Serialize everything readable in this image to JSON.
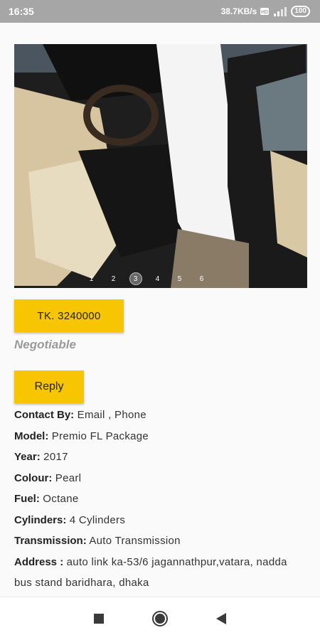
{
  "status_bar": {
    "time": "16:35",
    "network_speed": "38.7KB/s",
    "battery": "100",
    "icons": [
      "wifi-data-icon",
      "signal-icon",
      "battery-icon"
    ]
  },
  "gallery": {
    "image_alt": "car interior",
    "pages": [
      "1",
      "2",
      "3",
      "4",
      "5",
      "6"
    ],
    "active_page": "3"
  },
  "price": {
    "label": "TK. 3240000",
    "note": "Negotiable"
  },
  "actions": {
    "reply_label": "Reply"
  },
  "details": [
    {
      "key": "Contact By:",
      "value": " Email , Phone"
    },
    {
      "key": "Model:",
      "value": " Premio FL Package"
    },
    {
      "key": "Year:",
      "value": " 2017"
    },
    {
      "key": "Colour:",
      "value": " Pearl"
    },
    {
      "key": "Fuel:",
      "value": " Octane"
    },
    {
      "key": "Cylinders:",
      "value": " 4 Cylinders"
    },
    {
      "key": "Transmission:",
      "value": " Auto Transmission"
    },
    {
      "key": "Address :",
      "value": " auto link ka-53/6 jagannathpur,vatara, nadda bus stand baridhara, dhaka"
    }
  ],
  "colors": {
    "accent": "#f7c501",
    "status_bar": "#a6a6a6",
    "muted_text": "#9a9a9a"
  },
  "nav": {
    "icons": [
      "recents-square-icon",
      "home-circle-icon",
      "back-triangle-icon"
    ]
  }
}
